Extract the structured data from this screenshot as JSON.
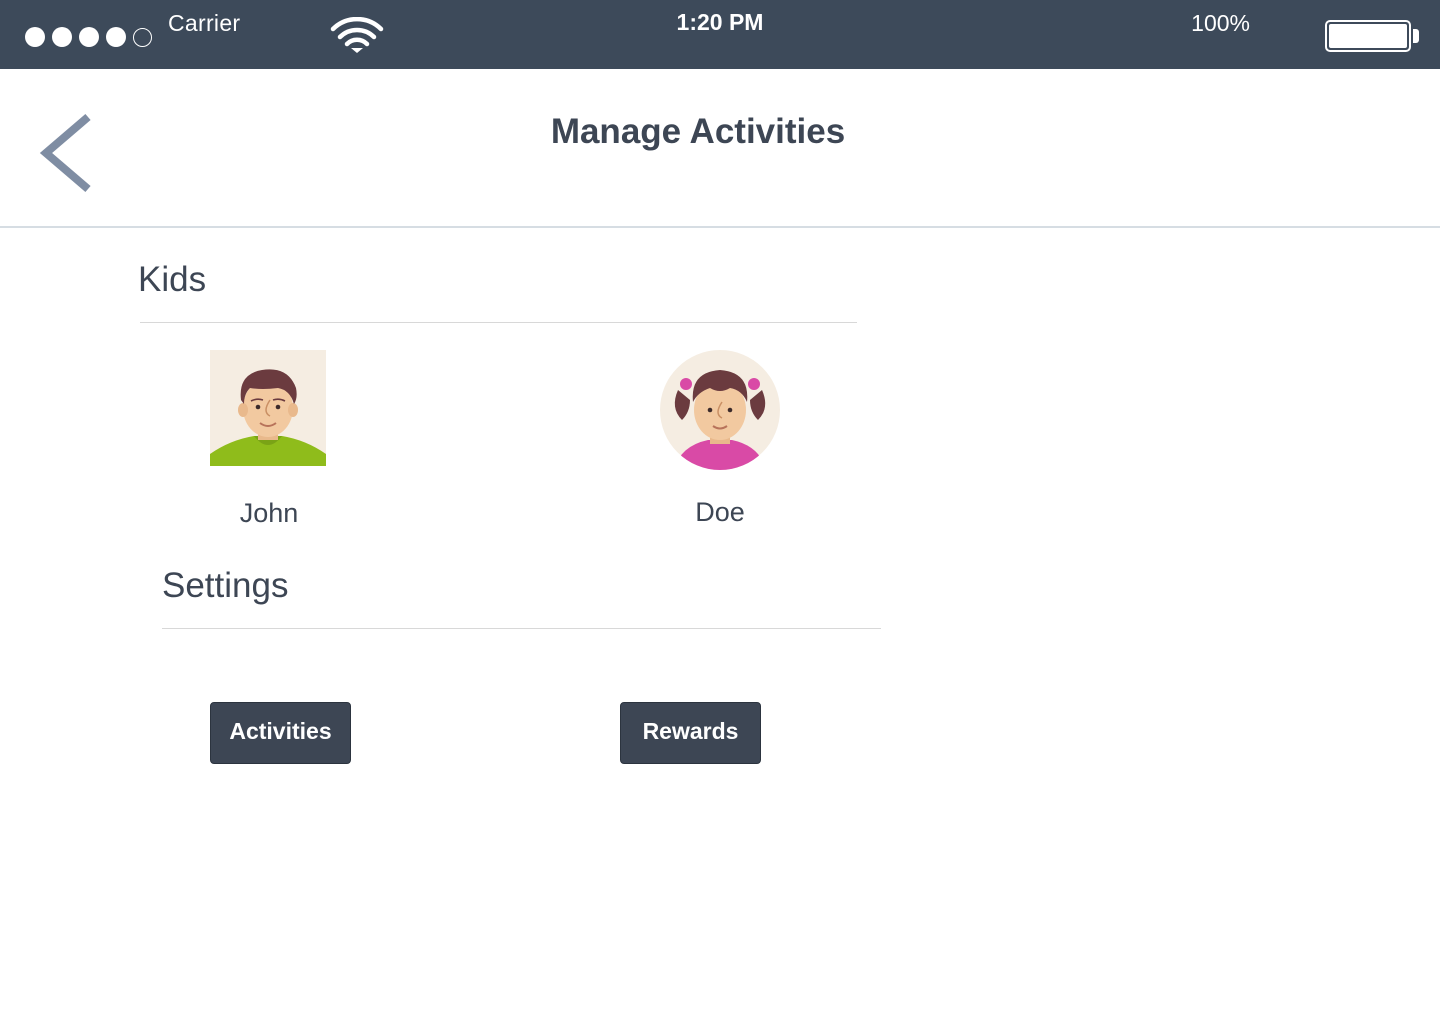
{
  "status_bar": {
    "carrier": "Carrier",
    "time": "1:20 PM",
    "battery_percent": "100%",
    "signal_strength": {
      "filled": 4,
      "total": 5
    },
    "battery_level": 1.0,
    "background_color": "#3d4a5a"
  },
  "nav": {
    "back_icon": "chevron-left-icon",
    "title": "Manage Activities"
  },
  "kids_section": {
    "title": "Kids",
    "kids": [
      {
        "name": "John",
        "avatar": "boy-avatar",
        "accent": "#8fbc1b"
      },
      {
        "name": "Doe",
        "avatar": "girl-avatar",
        "accent": "#d94aa6"
      }
    ]
  },
  "settings_section": {
    "title": "Settings",
    "buttons": [
      {
        "label": "Activities"
      },
      {
        "label": "Rewards"
      }
    ]
  },
  "colors": {
    "primary_dark": "#3d4654",
    "back_chevron": "#7f8da3",
    "divider": "#d8d8d8"
  }
}
